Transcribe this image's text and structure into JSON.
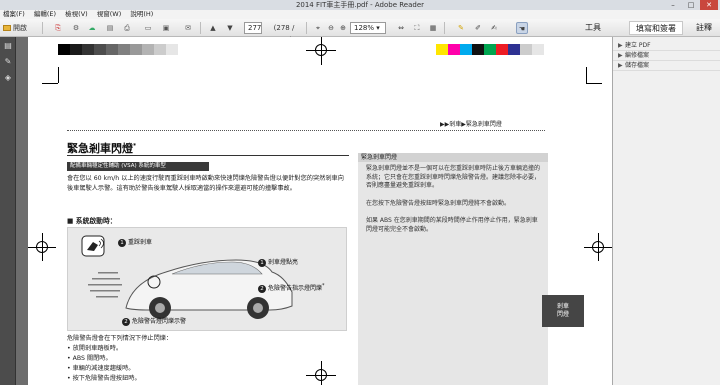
{
  "window": {
    "title": "2014 FIT車主手冊.pdf - Adobe Reader",
    "minimize": "–",
    "maximize": "□",
    "close": "✕"
  },
  "menu": [
    "檔案(F)",
    "編輯(E)",
    "檢視(V)",
    "視窗(W)",
    "說明(H)"
  ],
  "toolbar": {
    "open_label": "開啟",
    "page_current": "277",
    "page_info": "(278 / 366)",
    "zoom": "128%",
    "tools_label": "工具",
    "fill_sign_label": "填寫和簽署",
    "comment_label": "註釋",
    "icons": [
      "create-pdf-icon",
      "save-icon",
      "print-icon",
      "cloud-icon",
      "email-icon",
      "prev-page-icon",
      "next-page-icon",
      "zoom-out-icon",
      "zoom-in-icon",
      "fit-page-icon",
      "fullscreen-icon",
      "comment-icon",
      "highlight-icon",
      "sign-icon",
      "hand-tool-icon"
    ]
  },
  "right_panel": {
    "items": [
      "建立 PDF",
      "編修檔案",
      "儲存檔案"
    ]
  },
  "color_bar": {
    "grays": [
      "#000000",
      "#1a1a1a",
      "#333333",
      "#4d4d4d",
      "#666666",
      "#808080",
      "#999999",
      "#b3b3b3",
      "#cccccc",
      "#e6e6e6"
    ],
    "colors": [
      "#ffe600",
      "#ff00aa",
      "#00aaee",
      "#111111",
      "#00a550",
      "#ed1c24",
      "#2e3192",
      "#cccccc",
      "#e6e6e6"
    ]
  },
  "page": {
    "breadcrumb": "▶▶剎車▶緊急剎車閃燈",
    "title": "緊急剎車閃燈",
    "title_mark": "*",
    "tag": "配備車輛穩定性輔助 (VSA) 系統的車型",
    "body": "會在您以 60 km/h 以上的速度行駛而重踩剎車時啟動來快速閃爍危險警告燈以便針對您的突然剎車向後車駕駛人示警。這有助於警告後車駕駛人採取適當的操作來還避可能的撞擊事故。",
    "subhead": "■ 系統啟動時：",
    "callouts": {
      "c1": "重踩剎車",
      "c2": "剎車燈點亮",
      "c3": "危險警告指示燈閃爍",
      "c3_mark": "*",
      "c4": "危險警告燈閃爍示警"
    },
    "callout_numbers": [
      "1",
      "1",
      "2",
      "2"
    ],
    "list_intro": "危險警告燈會在下列情況下停止閃爍：",
    "list": [
      "• 放開剎車踏板時。",
      "• ABS 關閉時。",
      "• 車輛的減速度趨緩時。",
      "• 按下危險警告燈按鈕時。"
    ],
    "side_title": "緊急剎車閃燈",
    "side_paras": [
      "緊急剎車閃燈並不是一個可以在您重踩剎車時防止後方車輛追撞的系統；它只會在您重踩剎車時閃爍危險警告燈。建議您除非必要，否則應盡量避免重踩剎車。",
      "在您按下危險警告燈按鈕時緊急剎車閃燈將不會啟動。",
      "如果 ABS 在您剎車期間的某段時間停止作用停止作用，緊急剎車閃燈可能完全不會啟動。"
    ],
    "side_tab": "剎車\n閃燈"
  }
}
